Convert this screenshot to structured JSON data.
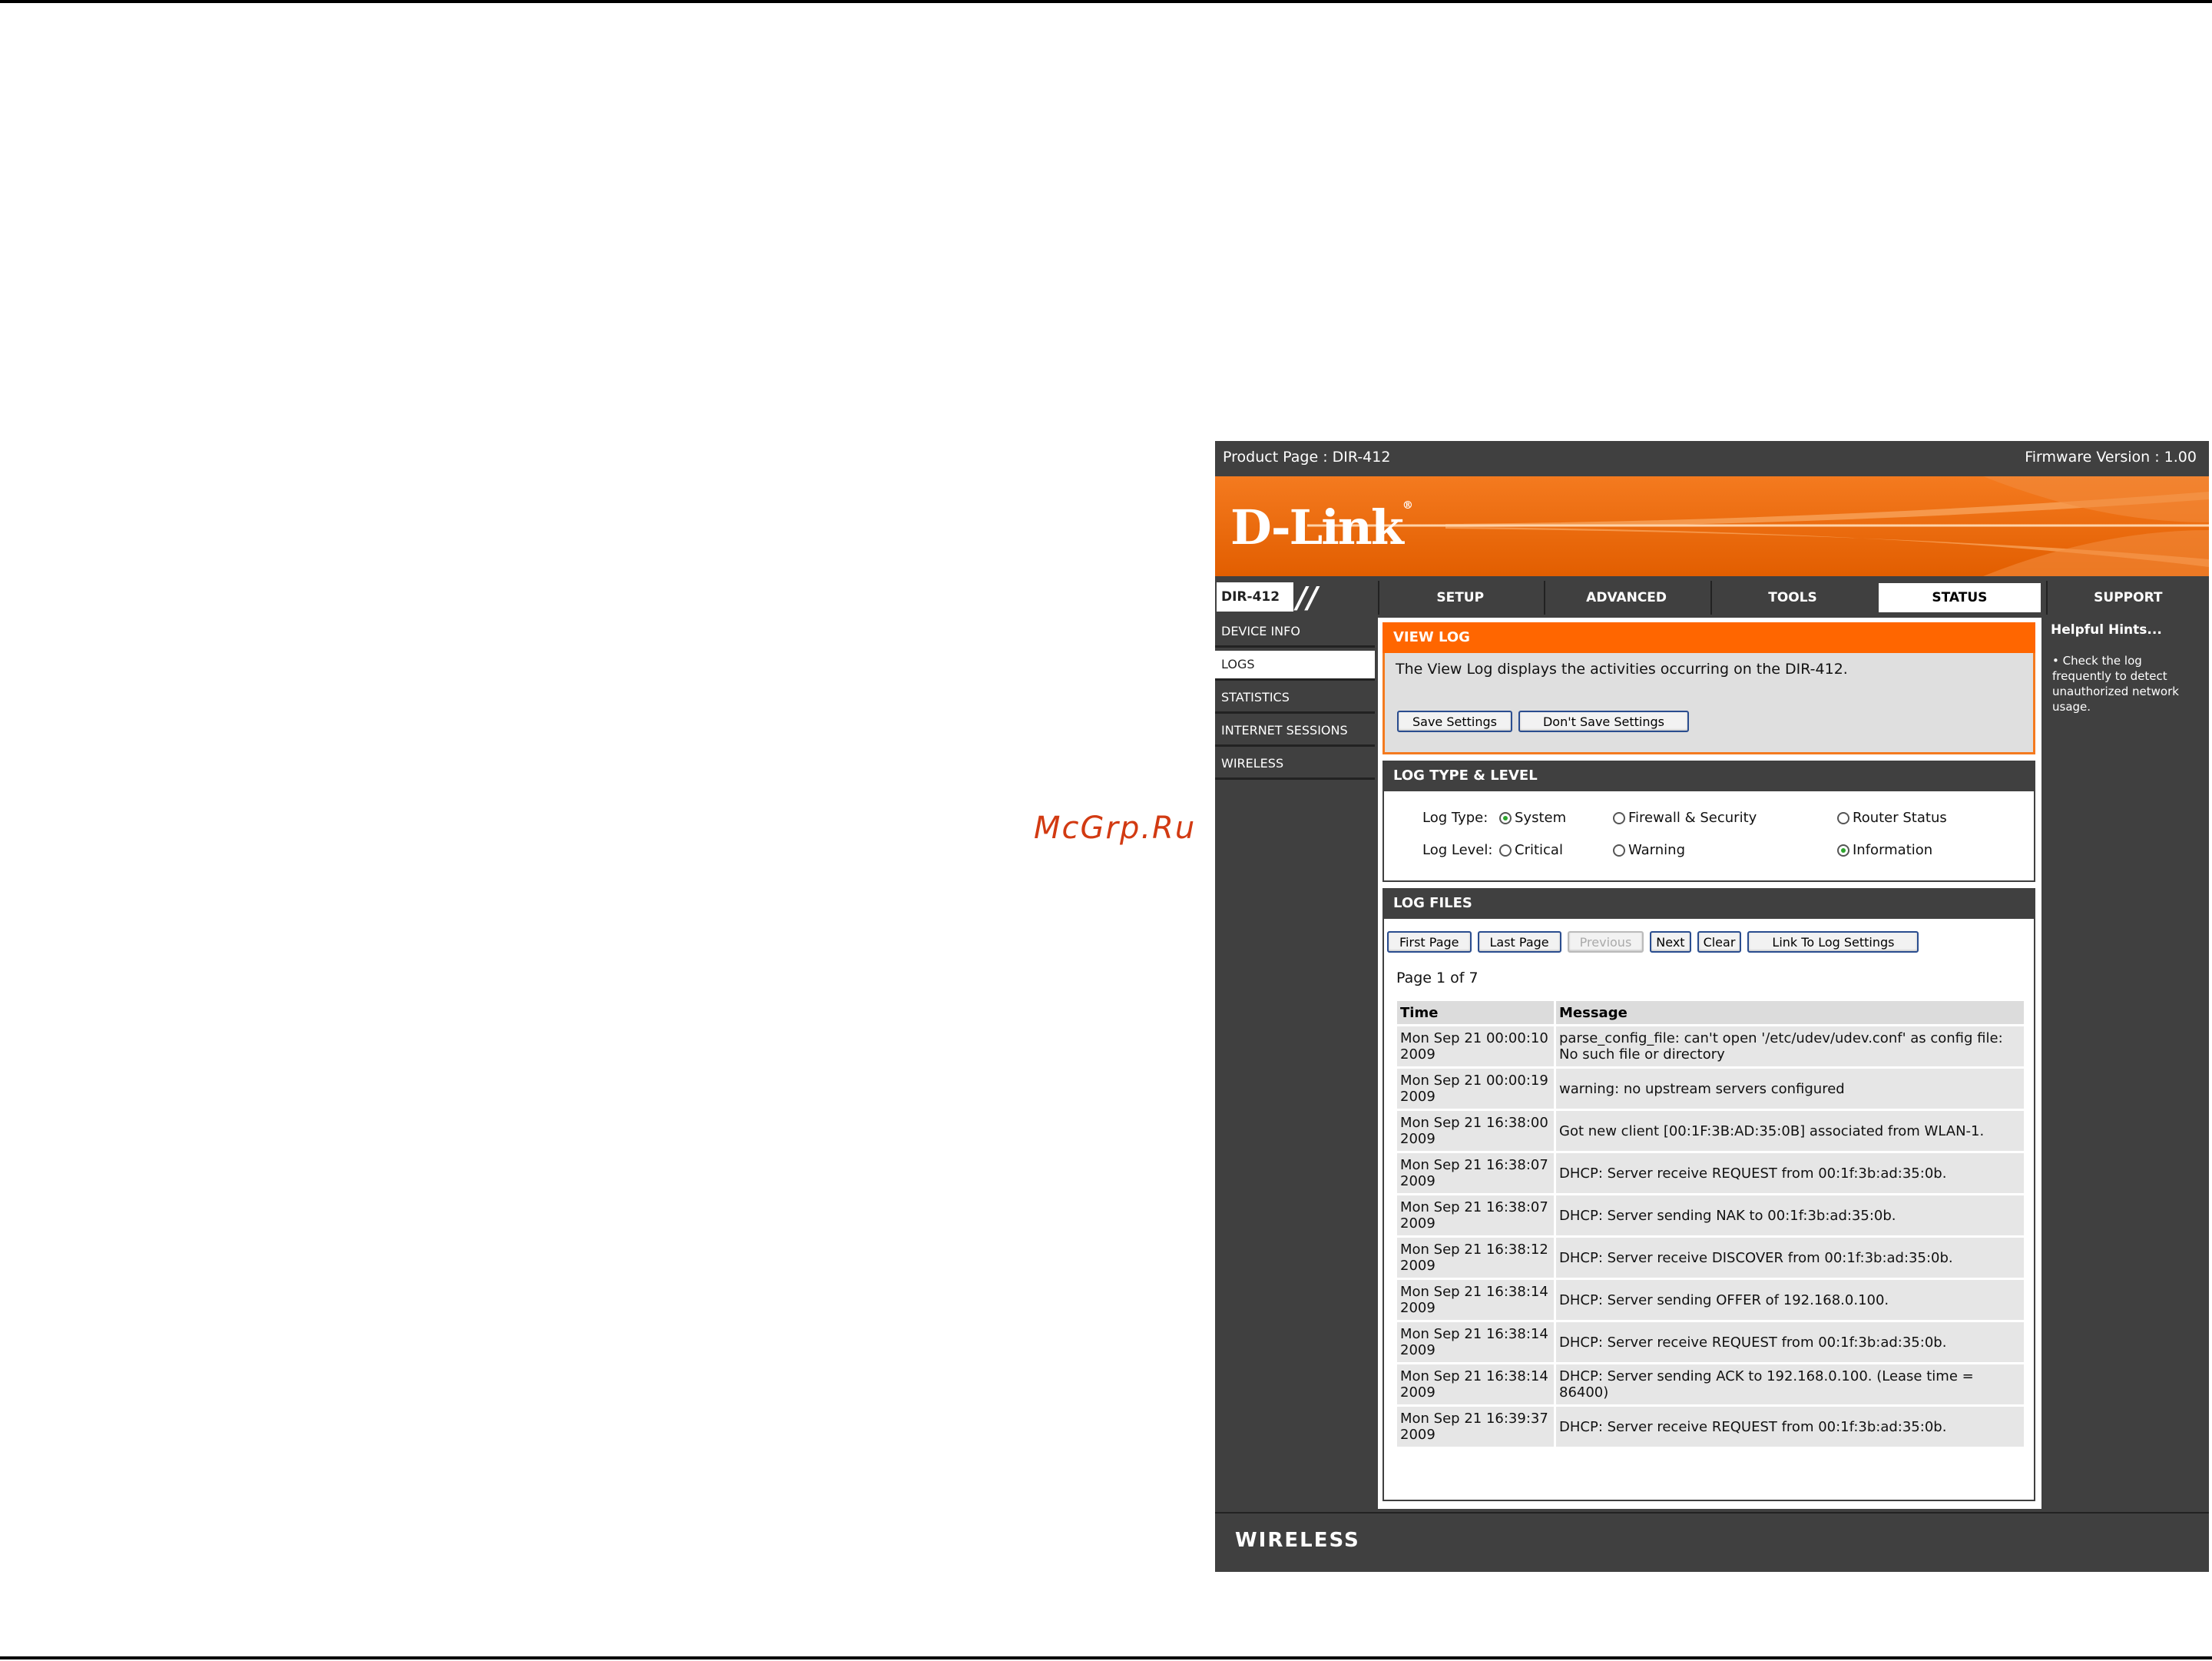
{
  "watermark": "McGrp.Ru",
  "topbar": {
    "product": "Product Page : DIR-412",
    "firmware": "Firmware Version : 1.00"
  },
  "brand": {
    "logo": "D-Link",
    "footer_word": "WIRELESS"
  },
  "nav": {
    "model": "DIR-412",
    "tabs": [
      {
        "label": "SETUP",
        "active": false
      },
      {
        "label": "ADVANCED",
        "active": false
      },
      {
        "label": "TOOLS",
        "active": false
      },
      {
        "label": "STATUS",
        "active": true
      },
      {
        "label": "SUPPORT",
        "active": false
      }
    ]
  },
  "sidebar": {
    "items": [
      {
        "label": "DEVICE INFO",
        "active": false
      },
      {
        "label": "LOGS",
        "active": true
      },
      {
        "label": "STATISTICS",
        "active": false
      },
      {
        "label": "INTERNET SESSIONS",
        "active": false
      },
      {
        "label": "WIRELESS",
        "active": false
      }
    ]
  },
  "view_log": {
    "title": "VIEW LOG",
    "description": "The View Log displays the activities occurring on the DIR-412.",
    "save_label": "Save Settings",
    "dont_save_label": "Don't Save Settings"
  },
  "log_type_level": {
    "title": "LOG TYPE & LEVEL",
    "type_label": "Log Type:",
    "level_label": "Log Level:",
    "types": [
      {
        "label": "System",
        "selected": true
      },
      {
        "label": "Firewall & Security",
        "selected": false
      },
      {
        "label": "Router Status",
        "selected": false
      }
    ],
    "levels": [
      {
        "label": "Critical",
        "selected": false
      },
      {
        "label": "Warning",
        "selected": false
      },
      {
        "label": "Information",
        "selected": true
      }
    ]
  },
  "log_files": {
    "title": "LOG FILES",
    "buttons": {
      "first": "First Page",
      "last": "Last Page",
      "previous": "Previous",
      "next": "Next",
      "clear": "Clear",
      "link": "Link To Log Settings"
    },
    "page_info": "Page 1 of 7",
    "columns": [
      "Time",
      "Message"
    ],
    "rows": [
      {
        "time": "Mon Sep 21 00:00:10 2009",
        "message": "parse_config_file: can't open '/etc/udev/udev.conf' as config file: No such file or directory"
      },
      {
        "time": "Mon Sep 21 00:00:19 2009",
        "message": "warning: no upstream servers configured"
      },
      {
        "time": "Mon Sep 21 16:38:00 2009",
        "message": "Got new client [00:1F:3B:AD:35:0B] associated from WLAN-1."
      },
      {
        "time": "Mon Sep 21 16:38:07 2009",
        "message": "DHCP: Server receive REQUEST from 00:1f:3b:ad:35:0b."
      },
      {
        "time": "Mon Sep 21 16:38:07 2009",
        "message": "DHCP: Server sending NAK to 00:1f:3b:ad:35:0b."
      },
      {
        "time": "Mon Sep 21 16:38:12 2009",
        "message": "DHCP: Server receive DISCOVER from 00:1f:3b:ad:35:0b."
      },
      {
        "time": "Mon Sep 21 16:38:14 2009",
        "message": "DHCP: Server sending OFFER of 192.168.0.100."
      },
      {
        "time": "Mon Sep 21 16:38:14 2009",
        "message": "DHCP: Server receive REQUEST from 00:1f:3b:ad:35:0b."
      },
      {
        "time": "Mon Sep 21 16:38:14 2009",
        "message": "DHCP: Server sending ACK to 192.168.0.100. (Lease time = 86400)"
      },
      {
        "time": "Mon Sep 21 16:39:37 2009",
        "message": "DHCP: Server receive REQUEST from 00:1f:3b:ad:35:0b."
      }
    ]
  },
  "hints": {
    "title": "Helpful Hints...",
    "text": "Check the log frequently to detect unauthorized network usage."
  },
  "colors": {
    "accent": "#ff6600",
    "dark": "#404040",
    "radio_on": "#2da52d"
  }
}
